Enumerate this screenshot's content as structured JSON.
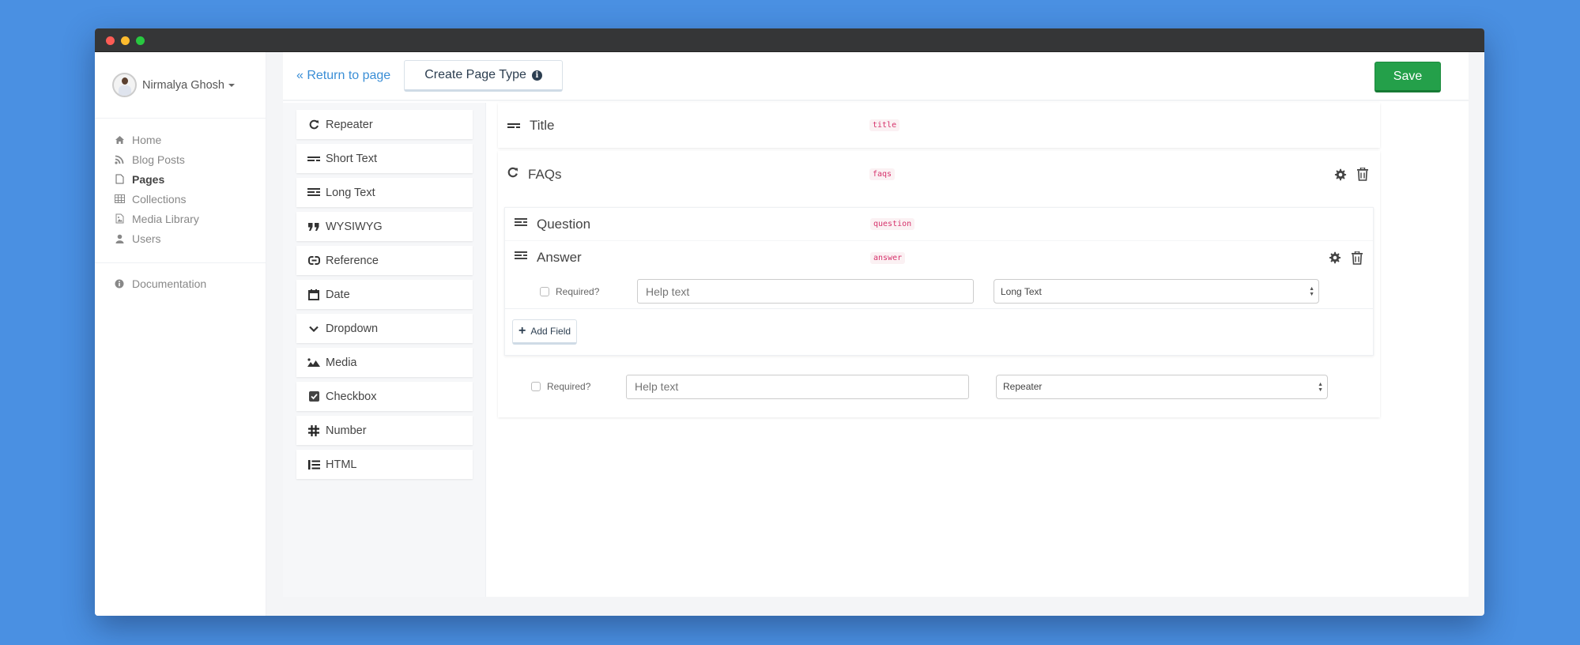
{
  "window": {
    "controls": [
      "close",
      "minimize",
      "maximize"
    ]
  },
  "sidebar": {
    "user": {
      "name": "Nirmalya Ghosh",
      "avatar_icon": "user-avatar"
    },
    "nav": [
      {
        "label": "Home",
        "icon": "home-icon",
        "active": false
      },
      {
        "label": "Blog Posts",
        "icon": "rss-icon",
        "active": false
      },
      {
        "label": "Pages",
        "icon": "file-icon",
        "active": true
      },
      {
        "label": "Collections",
        "icon": "table-icon",
        "active": false
      },
      {
        "label": "Media Library",
        "icon": "image-icon",
        "active": false
      },
      {
        "label": "Users",
        "icon": "user-icon",
        "active": false
      }
    ],
    "bottom_nav": [
      {
        "label": "Documentation",
        "icon": "info-circle-icon"
      }
    ]
  },
  "header": {
    "return_link": "« Return to page",
    "tab_label": "Create Page Type",
    "tab_icon": "info-circle-icon",
    "save_label": "Save",
    "save_color": "#24a04a"
  },
  "field_types": [
    {
      "label": "Repeater",
      "icon": "repeat-icon"
    },
    {
      "label": "Short Text",
      "icon": "short-text-icon"
    },
    {
      "label": "Long Text",
      "icon": "long-text-icon"
    },
    {
      "label": "WYSIWYG",
      "icon": "quote-icon"
    },
    {
      "label": "Reference",
      "icon": "link-icon"
    },
    {
      "label": "Date",
      "icon": "calendar-icon"
    },
    {
      "label": "Dropdown",
      "icon": "chevron-down-icon"
    },
    {
      "label": "Media",
      "icon": "image-icon"
    },
    {
      "label": "Checkbox",
      "icon": "checkbox-icon"
    },
    {
      "label": "Number",
      "icon": "hash-icon"
    },
    {
      "label": "HTML",
      "icon": "list-icon"
    }
  ],
  "fields": {
    "title": {
      "name": "Title",
      "key": "title",
      "icon": "short-text-icon"
    },
    "faqs": {
      "name": "FAQs",
      "key": "faqs",
      "icon": "repeat-icon",
      "children": {
        "question": {
          "name": "Question",
          "key": "question",
          "icon": "long-text-icon"
        },
        "answer": {
          "name": "Answer",
          "key": "answer",
          "icon": "long-text-icon",
          "required_label": "Required?",
          "required": false,
          "help_placeholder": "Help text",
          "help_value": "",
          "type_selected": "Long Text"
        }
      },
      "add_field_label": "Add Field",
      "required_label": "Required?",
      "required": false,
      "help_placeholder": "Help text",
      "help_value": "",
      "type_selected": "Repeater"
    }
  }
}
